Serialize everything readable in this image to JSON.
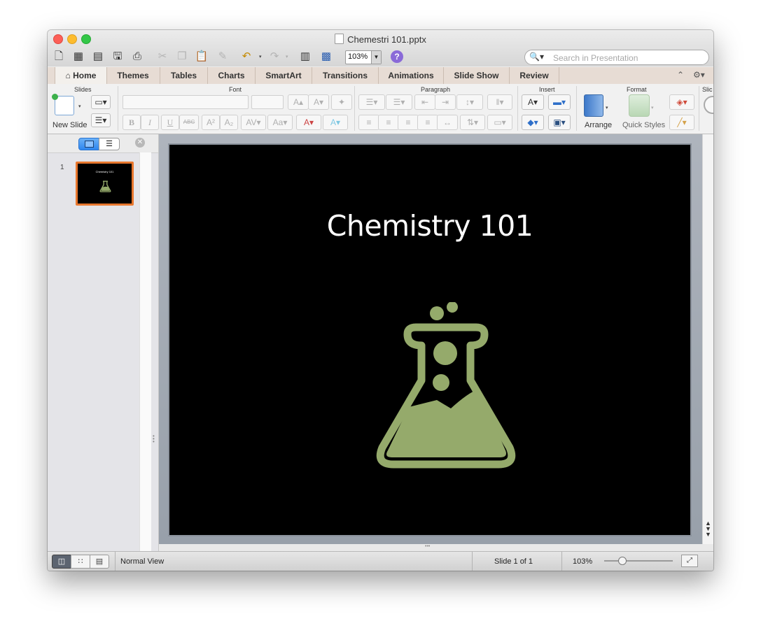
{
  "window": {
    "title": "Chemestri 101.pptx"
  },
  "toolbar": {
    "zoom_value": "103%",
    "search_placeholder": "Search in Presentation"
  },
  "tabs": [
    {
      "label": "Home"
    },
    {
      "label": "Themes"
    },
    {
      "label": "Tables"
    },
    {
      "label": "Charts"
    },
    {
      "label": "SmartArt"
    },
    {
      "label": "Transitions"
    },
    {
      "label": "Animations"
    },
    {
      "label": "Slide Show"
    },
    {
      "label": "Review"
    }
  ],
  "ribbon": {
    "groups": {
      "slides": "Slides",
      "font": "Font",
      "paragraph": "Paragraph",
      "insert": "Insert",
      "format": "Format",
      "slide_show_cut": "Slic"
    },
    "new_slide_label": "New Slide",
    "arrange_label": "Arrange",
    "quick_styles_label": "Quick Styles"
  },
  "slides_pane": {
    "slide_number": "1",
    "thumb_title": "Chemistry 101"
  },
  "slide": {
    "title": "Chemistry 101",
    "icon": "chemistry-flask-icon",
    "icon_color": "#95aa6b",
    "background": "#000000"
  },
  "status": {
    "view_label": "Normal View",
    "slide_counter": "Slide 1 of 1",
    "zoom": "103%"
  },
  "colors": {
    "thumb_border": "#e8772e",
    "tab_bar": "#e7dcd4"
  }
}
